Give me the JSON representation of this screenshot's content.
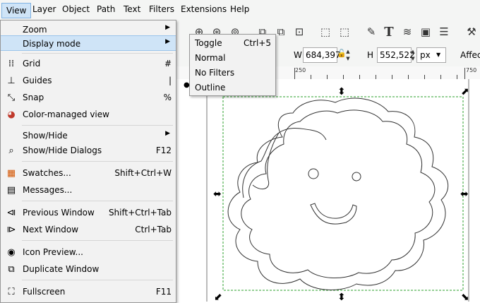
{
  "menubar": [
    "View",
    "Layer",
    "Object",
    "Path",
    "Text",
    "Filters",
    "Extensions",
    "Help"
  ],
  "view_menu": {
    "zoom": {
      "label": "Zoom"
    },
    "display_mode": {
      "label": "Display mode"
    },
    "grid": {
      "label": "Grid",
      "shortcut": "#"
    },
    "guides": {
      "label": "Guides",
      "shortcut": "|"
    },
    "snap": {
      "label": "Snap",
      "shortcut": "%"
    },
    "color_managed": {
      "label": "Color-managed view"
    },
    "show_hide": {
      "label": "Show/Hide"
    },
    "show_hide_dialogs": {
      "label": "Show/Hide Dialogs",
      "shortcut": "F12"
    },
    "swatches": {
      "label": "Swatches...",
      "shortcut": "Shift+Ctrl+W"
    },
    "messages": {
      "label": "Messages..."
    },
    "previous_window": {
      "label": "Previous Window",
      "shortcut": "Shift+Ctrl+Tab"
    },
    "next_window": {
      "label": "Next Window",
      "shortcut": "Ctrl+Tab"
    },
    "icon_preview": {
      "label": "Icon Preview..."
    },
    "duplicate_window": {
      "label": "Duplicate Window"
    },
    "fullscreen": {
      "label": "Fullscreen",
      "shortcut": "F11"
    }
  },
  "display_submenu": {
    "toggle": {
      "label": "Toggle",
      "shortcut": "Ctrl+5"
    },
    "normal": {
      "label": "Normal"
    },
    "no_filters": {
      "label": "No Filters"
    },
    "outline": {
      "label": "Outline",
      "selected": true
    }
  },
  "controls": {
    "w_label": "W",
    "w_value": "684,397",
    "h_label": "H",
    "h_value": "552,522",
    "unit": "px",
    "affect_label": "Affect"
  },
  "ruler": {
    "label_250": "250",
    "label_750": "750"
  },
  "icons": {
    "toolbar": [
      "zoom-drawing-icon",
      "zoom-page-icon",
      "zoom-width-icon",
      "duplicate-icon",
      "clone-icon",
      "unlink-clone-icon",
      "group-icon",
      "ungroup-icon",
      "xml-editor-icon",
      "text-font-icon",
      "layers-icon",
      "object-properties-icon",
      "align-icon",
      "preferences-icon"
    ]
  },
  "colors": {
    "highlight": "#cfe4f7",
    "highlight_border": "#7fb2e2",
    "selection_dash": "#2ea02e"
  }
}
